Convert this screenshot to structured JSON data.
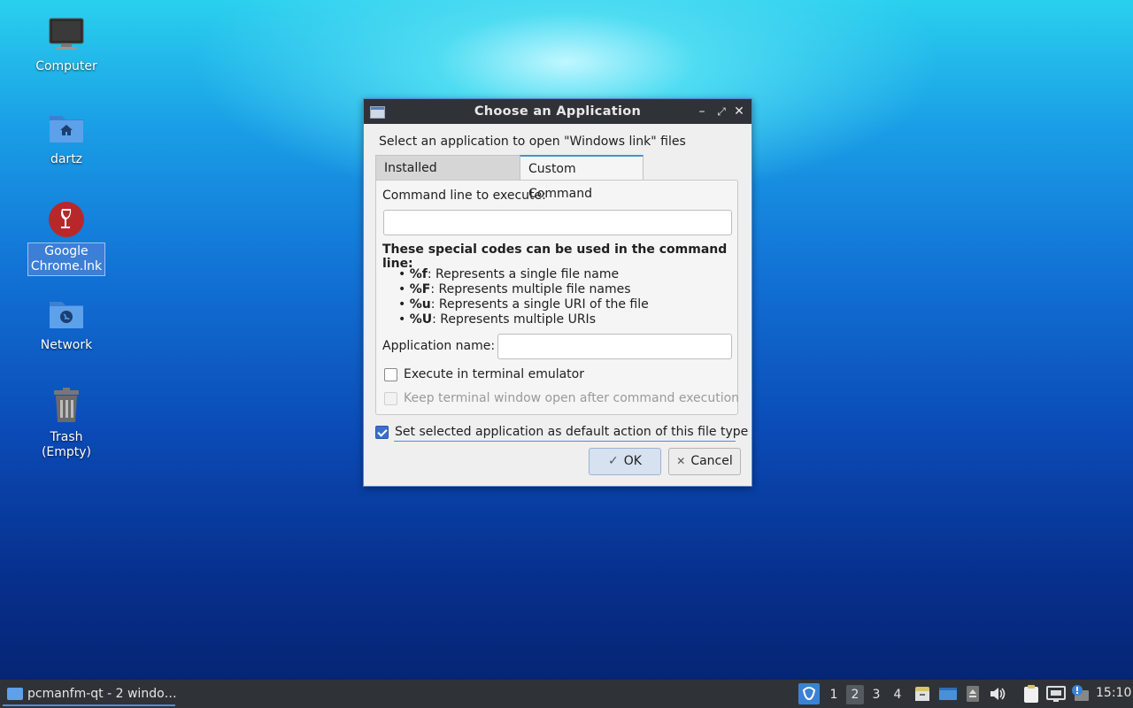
{
  "desktop": {
    "icons": [
      {
        "label": "Computer",
        "icon": "computer-icon"
      },
      {
        "label": "dartz",
        "icon": "home-folder-icon"
      },
      {
        "label": "Google Chrome.lnk",
        "label_line1": "Google",
        "label_line2": "Chrome.lnk",
        "icon": "wine-icon",
        "selected": true
      },
      {
        "label": "Network",
        "icon": "network-folder-icon"
      },
      {
        "label": "Trash (Empty)",
        "icon": "trash-icon"
      }
    ]
  },
  "dialog": {
    "title": "Choose an Application",
    "prompt": "Select an application to open \"Windows link\" files",
    "tabs": [
      {
        "label": "Installed Applications",
        "active": false
      },
      {
        "label": "Custom Command",
        "active": true
      }
    ],
    "command_label": "Command line to execute:",
    "command_value": "",
    "codes_heading": "These special codes can be used in the command line:",
    "codes": [
      {
        "code": "%f",
        "desc": ": Represents a single file name"
      },
      {
        "code": "%F",
        "desc": ": Represents multiple file names"
      },
      {
        "code": "%u",
        "desc": ": Represents a single URI of the file"
      },
      {
        "code": "%U",
        "desc": ": Represents multiple URIs"
      }
    ],
    "bullet": "•",
    "app_name_label": "Application name:",
    "app_name_value": "",
    "exec_terminal_label": "Execute in terminal emulator",
    "exec_terminal_checked": false,
    "keep_open_label": "Keep terminal window open after command execution",
    "keep_open_enabled": false,
    "set_default_label": "Set selected application as default action of this file type",
    "set_default_checked": true,
    "ok_label": "OK",
    "cancel_label": "Cancel",
    "ok_glyph": "✓",
    "cancel_glyph": "✕",
    "minimize_glyph": "–",
    "maximize_glyph": "⤢",
    "close_glyph": "✕"
  },
  "taskbar": {
    "task_label": "pcmanfm-qt - 2 windo…",
    "workspaces": [
      "1",
      "2",
      "3",
      "4"
    ],
    "active_workspace": "2",
    "clock": "15:10",
    "accent": "#4a90d9"
  }
}
